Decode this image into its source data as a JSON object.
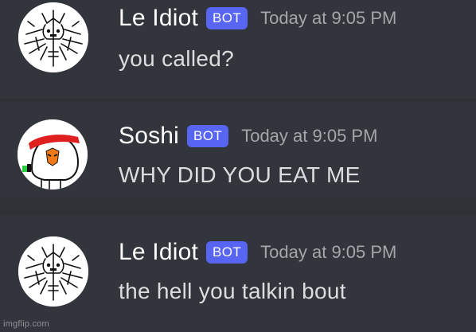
{
  "messages": [
    {
      "username": "Le Idiot",
      "tag": "BOT",
      "timestamp": "Today at 9:05 PM",
      "content": "you called?",
      "avatar": "sketch-creature-avatar"
    },
    {
      "username": "Soshi",
      "tag": "BOT",
      "timestamp": "Today at 9:05 PM",
      "content": "WHY DID YOU EAT ME",
      "avatar": "red-bandana-character-avatar"
    },
    {
      "username": "Le Idiot",
      "tag": "BOT",
      "timestamp": "Today at 9:05 PM",
      "content": "the hell you talkin bout",
      "avatar": "sketch-creature-avatar"
    }
  ],
  "watermark": "imgflip.com",
  "colors": {
    "background": "#36393f",
    "bot_tag": "#5865f2",
    "username": "#ffffff",
    "timestamp": "#a3a6aa",
    "content": "#dcddde"
  }
}
